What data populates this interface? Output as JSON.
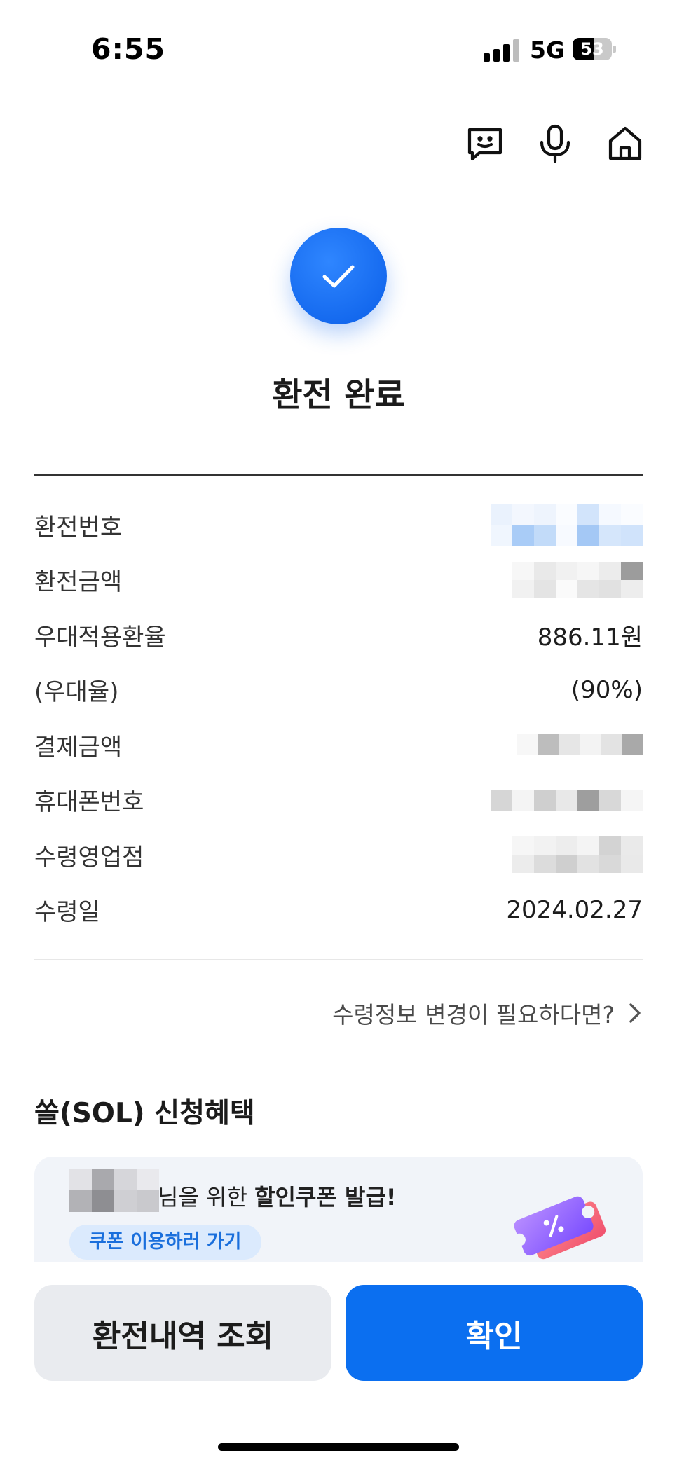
{
  "status_bar": {
    "time": "6:55",
    "network": "5G",
    "battery_level": "53",
    "battery_percent": 53
  },
  "header": {
    "icons": [
      "chatbot-icon",
      "microphone-icon",
      "home-icon"
    ]
  },
  "result": {
    "title": "환전 완료",
    "accent_color": "#0b6ff0"
  },
  "info": {
    "exchange_number_label": "환전번호",
    "exchange_amount_label": "환전금액",
    "preferential_rate_label": "우대적용환율",
    "preferential_rate_value": "886.11원",
    "discount_rate_label": "(우대율)",
    "discount_rate_value": "(90%)",
    "payment_amount_label": "결제금액",
    "phone_number_label": "휴대폰번호",
    "branch_label": "수령영업점",
    "pickup_date_label": "수령일",
    "pickup_date_value": "2024.02.27"
  },
  "change_link": {
    "label": "수령정보 변경이 필요하다면?"
  },
  "benefits": {
    "title": "쏠(SOL) 신청혜택",
    "coupon_text_prefix": "님을 위한 ",
    "coupon_text_bold": "할인쿠폰 발급!",
    "coupon_button": "쿠폰 이용하러 가기"
  },
  "buttons": {
    "history": "환전내역 조회",
    "confirm": "확인"
  }
}
